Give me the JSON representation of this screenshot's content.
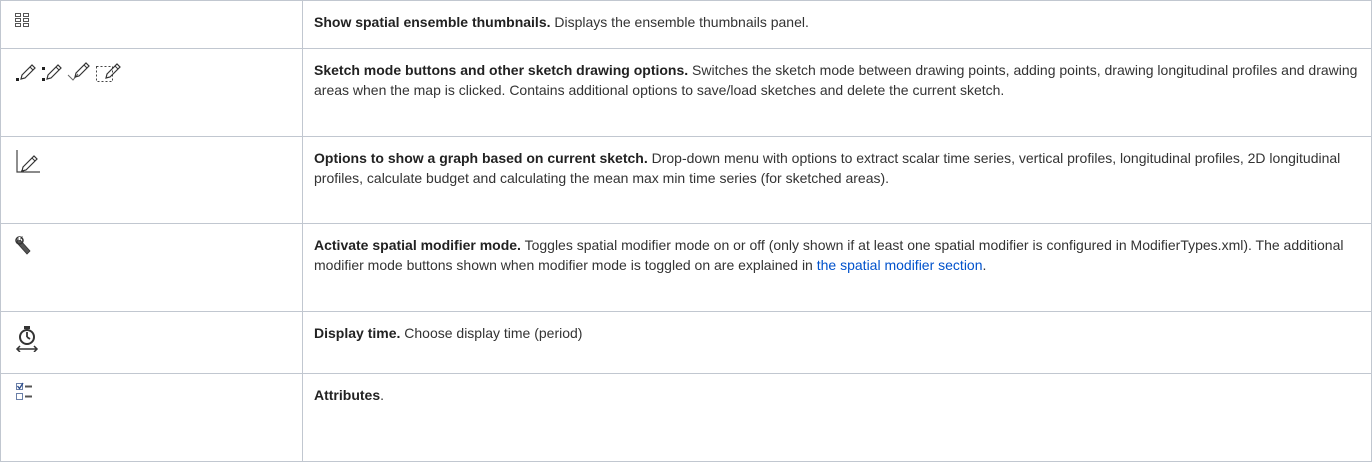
{
  "rows": [
    {
      "icon": "ensemble-thumbnails-icon",
      "title": "Show spatial ensemble thumbnails.",
      "text": " Displays the ensemble thumbnails panel."
    },
    {
      "icon": "sketch-mode-icons",
      "title": "Sketch mode buttons and other sketch drawing options.",
      "text": " Switches the sketch mode between drawing points, adding points, drawing longitudinal profiles and drawing areas when the map is clicked. Contains additional options to save/load sketches and delete the current sketch."
    },
    {
      "icon": "sketch-graph-icon",
      "title": "Options to show a graph based on current sketch.",
      "text": " Drop-down menu with options to extract scalar time series, vertical profiles, longitudinal profiles, 2D longitudinal profiles, calculate budget and calculating the mean max min time series (for sketched areas)."
    },
    {
      "icon": "wrench-icon",
      "title": "Activate spatial modifier mode.",
      "text": " Toggles spatial modifier mode on or off (only shown if at least one spatial modifier is configured in ModifierTypes.xml). The additional modifier mode buttons shown when modifier mode is toggled on are explained in ",
      "link": "the spatial modifier section",
      "after": "."
    },
    {
      "icon": "stopwatch-icon",
      "title": "Display time.",
      "text": " Choose display time (period)"
    },
    {
      "icon": "attributes-checklist-icon",
      "title": "Attributes",
      "after": "."
    }
  ]
}
